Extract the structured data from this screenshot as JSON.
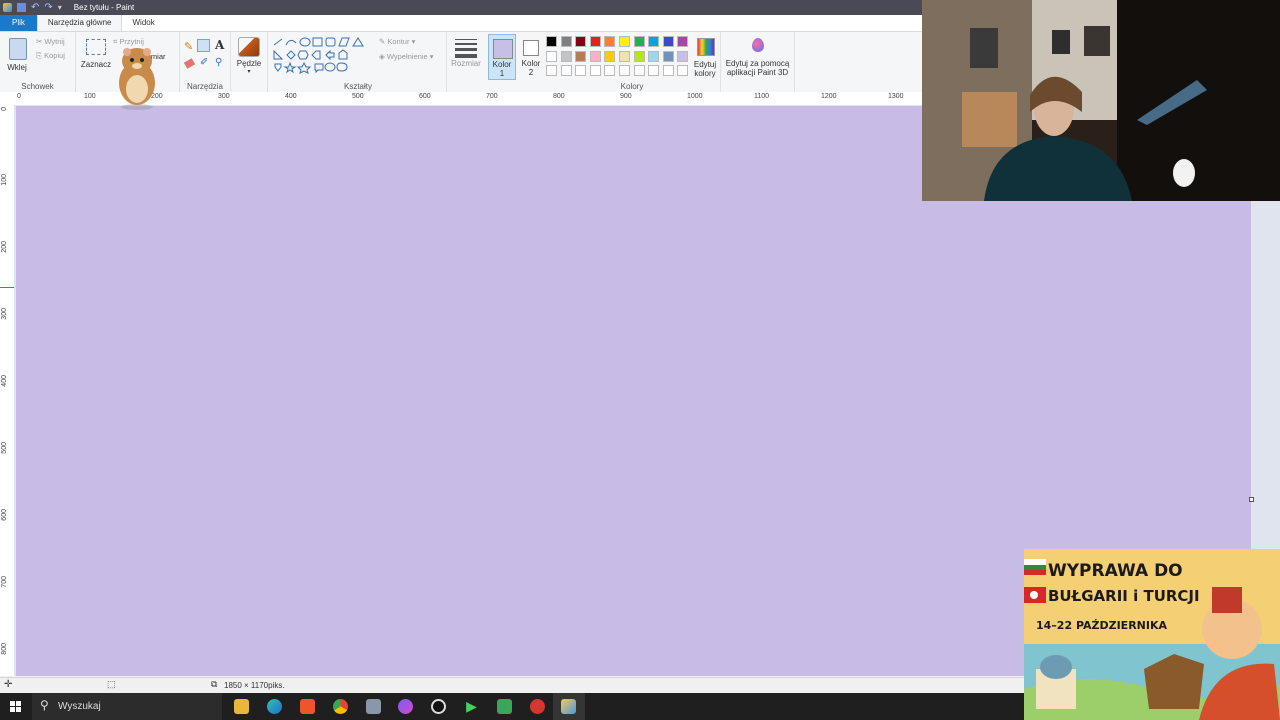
{
  "window": {
    "title": "Bez tytułu - Paint"
  },
  "menu": {
    "file": "Plik",
    "home": "Narzędzia główne",
    "view": "Widok"
  },
  "ribbon": {
    "clipboard": {
      "label": "Schowek",
      "paste": "Wklej",
      "cut": "Wytnij",
      "copy": "Kopiuj"
    },
    "image": {
      "select": "Zaznacz",
      "crop": "Przytnij",
      "resize": "Zmień rozmiar",
      "resize_visible": "ozmiar"
    },
    "tools": {
      "label": "Narzędzia",
      "text_glyph": "A"
    },
    "brushes": {
      "label": "Pędzle"
    },
    "shapes": {
      "label": "Kształty",
      "outline": "Kontur",
      "fill": "Wypełnienie"
    },
    "size": {
      "label": "Rozmiar"
    },
    "color1": {
      "label1": "Kolor",
      "label2": "1"
    },
    "color2": {
      "label1": "Kolor",
      "label2": "2"
    },
    "colors": {
      "label": "Kolory",
      "row1": [
        "#000000",
        "#7f7f7f",
        "#880015",
        "#ed1c24",
        "#ff7f27",
        "#fff200",
        "#22b14c",
        "#00a2e8",
        "#3f48cc",
        "#a349a4"
      ],
      "row2": [
        "#ffffff",
        "#c3c3c3",
        "#b97a57",
        "#ffaec9",
        "#ffc90e",
        "#efe4b0",
        "#b5e61d",
        "#99d9ea",
        "#7092be",
        "#c8bfe7"
      ],
      "row3": [
        "#ffffff",
        "#ffffff",
        "#ffffff",
        "#ffffff",
        "#ffffff",
        "#ffffff",
        "#ffffff",
        "#ffffff",
        "#ffffff",
        "#ffffff"
      ]
    },
    "edit_colors": {
      "l1": "Edytuj",
      "l2": "kolory"
    },
    "paint3d": {
      "l1": "Edytuj za pomocą",
      "l2": "aplikacji Paint 3D"
    }
  },
  "ruler": {
    "h": [
      "0",
      "100",
      "200",
      "300",
      "400",
      "500",
      "600",
      "700",
      "800",
      "900",
      "1000",
      "1100",
      "1200",
      "1300"
    ],
    "v": [
      "0",
      "100",
      "200",
      "300",
      "400",
      "500",
      "600",
      "700",
      "800"
    ]
  },
  "canvas": {
    "color": "#c8bce7"
  },
  "status": {
    "dimensions": "1850 × 1170piks."
  },
  "taskbar": {
    "search": "Wyszukaj"
  },
  "banner": {
    "line1": "WYPRAWA DO",
    "line2": "BUŁGARII i TURCJI",
    "line3": "14–22 PAŹDZIERNIKA"
  }
}
